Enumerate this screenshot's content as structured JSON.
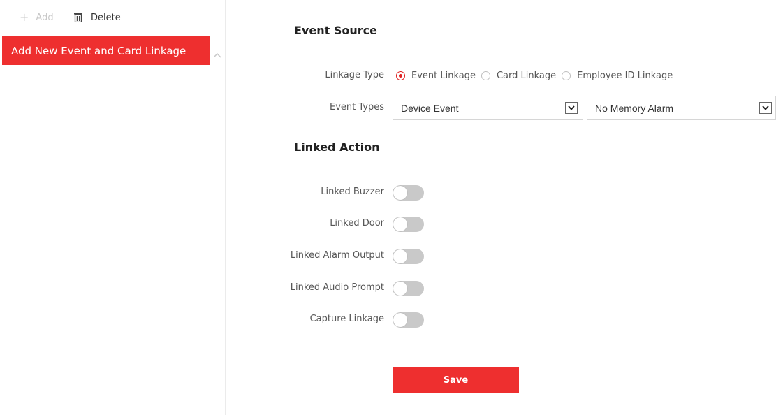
{
  "toolbar": {
    "add_label": "Add",
    "add_icon": "plus-icon",
    "delete_label": "Delete",
    "delete_icon": "trash-icon"
  },
  "list": {
    "items": [
      {
        "label": "Add New Event and Card Linkage",
        "selected": true
      }
    ]
  },
  "event_source": {
    "title": "Event Source",
    "linkage_type": {
      "label": "Linkage Type",
      "options": [
        "Event Linkage",
        "Card Linkage",
        "Employee ID Linkage"
      ],
      "selected": "Event Linkage"
    },
    "event_types": {
      "label": "Event Types",
      "primary_value": "Device Event",
      "secondary_value": "No Memory Alarm"
    }
  },
  "linked_action": {
    "title": "Linked Action",
    "toggles": [
      {
        "label": "Linked Buzzer",
        "on": false
      },
      {
        "label": "Linked Door",
        "on": false
      },
      {
        "label": "Linked Alarm Output",
        "on": false
      },
      {
        "label": "Linked Audio Prompt",
        "on": false
      },
      {
        "label": "Capture Linkage",
        "on": false
      }
    ]
  },
  "save_label": "Save",
  "colors": {
    "accent": "#ee2f2f",
    "toggle_off": "#c9c9c9"
  }
}
